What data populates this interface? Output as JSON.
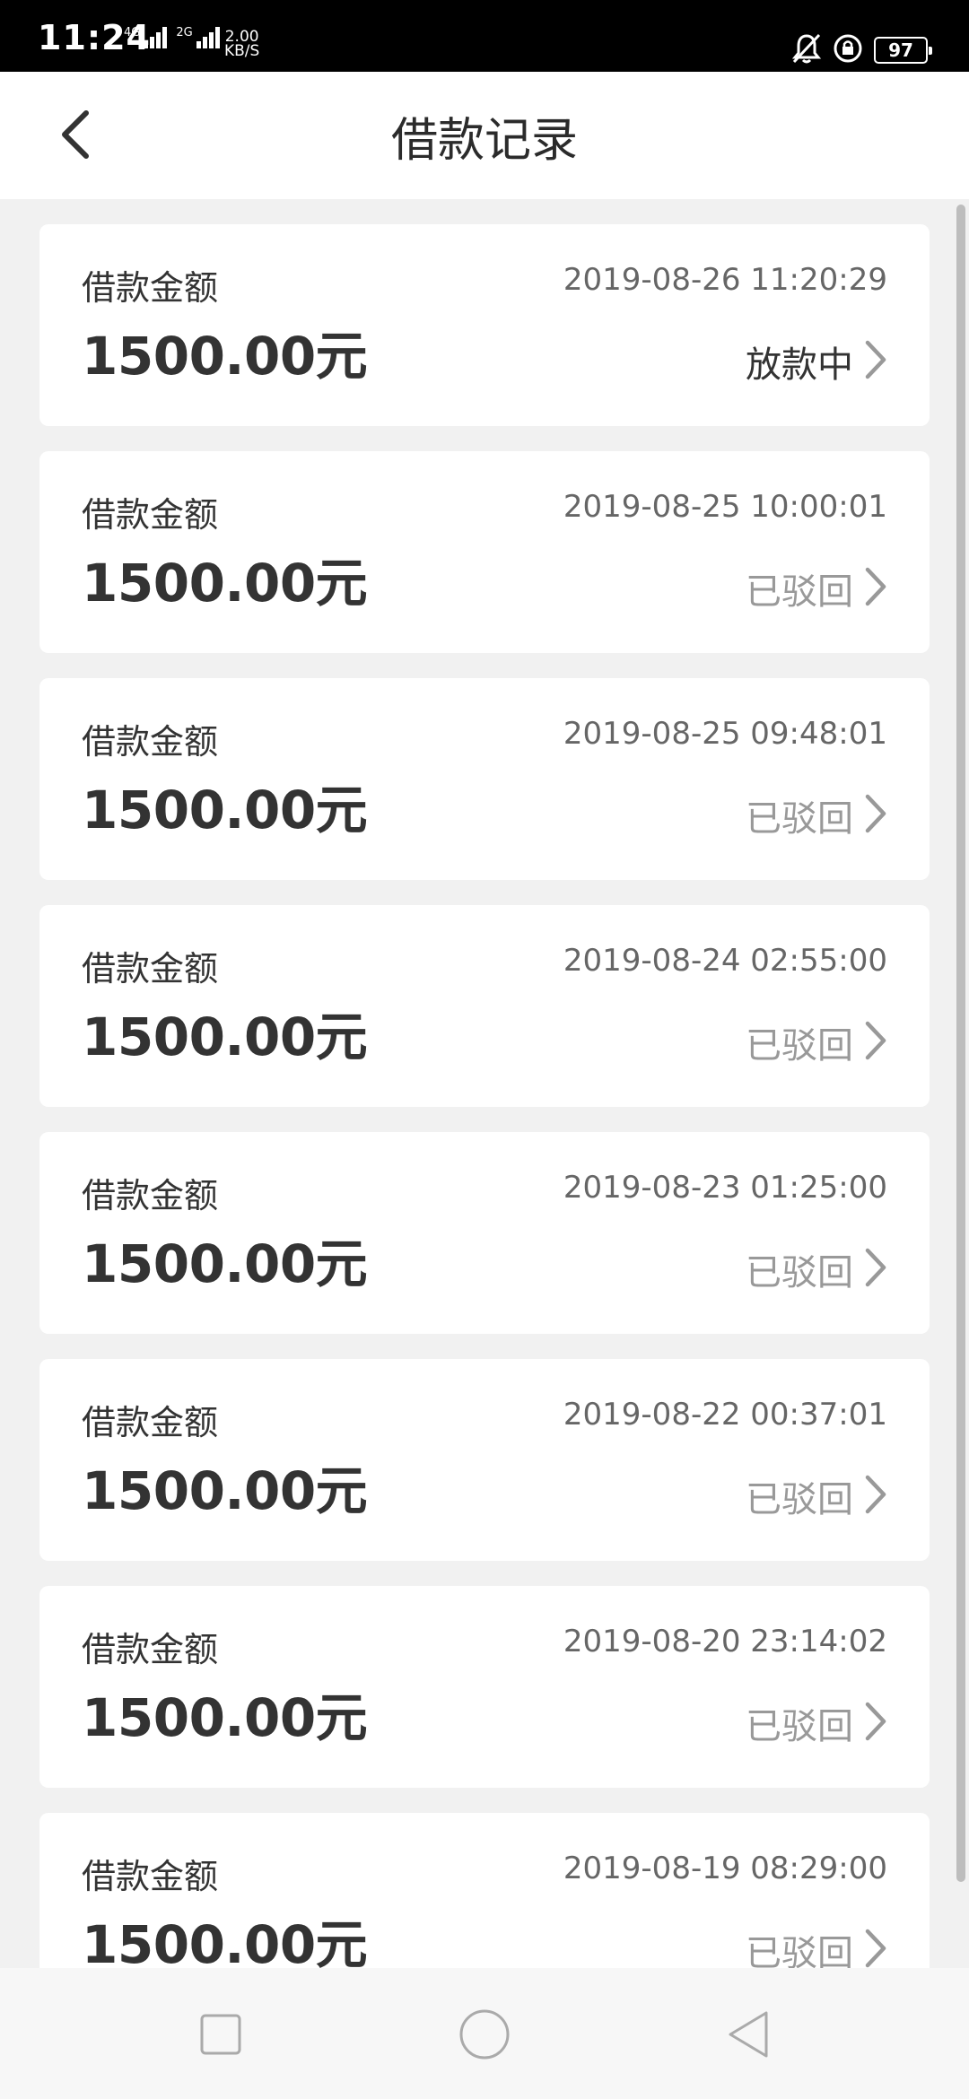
{
  "status_bar": {
    "time": "11:24",
    "signal1_tag": "4G",
    "signal2_tag": "2G",
    "net_speed_value": "2.00",
    "net_speed_unit": "KB/S",
    "battery": "97"
  },
  "header": {
    "title": "借款记录"
  },
  "records": [
    {
      "label": "借款金额",
      "time": "2019-08-26 11:20:29",
      "amount": "1500.00元",
      "status": "放款中"
    },
    {
      "label": "借款金额",
      "time": "2019-08-25 10:00:01",
      "amount": "1500.00元",
      "status": "已驳回"
    },
    {
      "label": "借款金额",
      "time": "2019-08-25 09:48:01",
      "amount": "1500.00元",
      "status": "已驳回"
    },
    {
      "label": "借款金额",
      "time": "2019-08-24 02:55:00",
      "amount": "1500.00元",
      "status": "已驳回"
    },
    {
      "label": "借款金额",
      "time": "2019-08-23 01:25:00",
      "amount": "1500.00元",
      "status": "已驳回"
    },
    {
      "label": "借款金额",
      "time": "2019-08-22 00:37:01",
      "amount": "1500.00元",
      "status": "已驳回"
    },
    {
      "label": "借款金额",
      "time": "2019-08-20 23:14:02",
      "amount": "1500.00元",
      "status": "已驳回"
    },
    {
      "label": "借款金额",
      "time": "2019-08-19 08:29:00",
      "amount": "1500.00元",
      "status": "已驳回"
    }
  ],
  "icons": {
    "back": "chevron-left-icon",
    "row_arrow": "chevron-right-icon",
    "bell": "bell-muted-icon",
    "lock": "rotation-lock-icon",
    "recent": "square-icon",
    "home": "circle-icon",
    "back_nav": "triangle-back-icon"
  }
}
